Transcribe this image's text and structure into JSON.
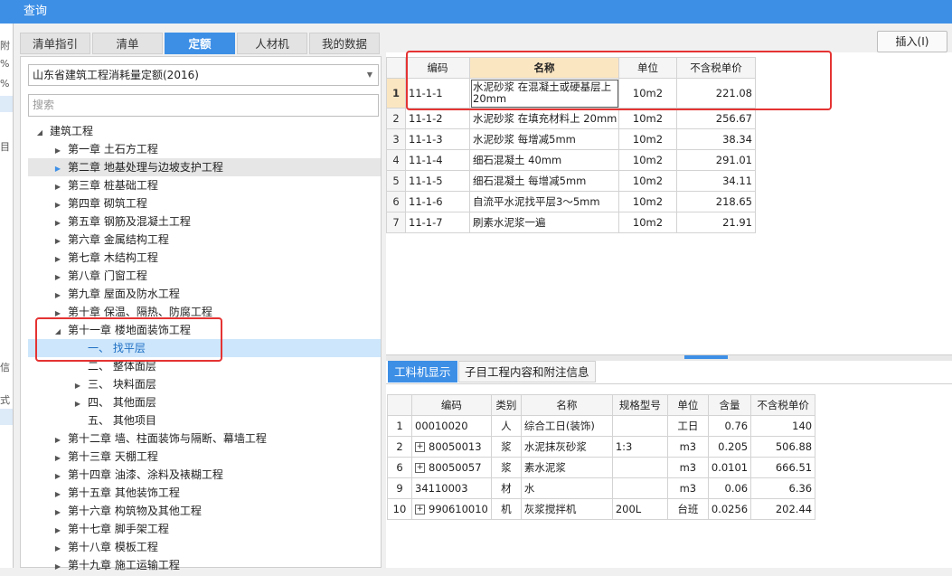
{
  "window": {
    "title": "查询"
  },
  "tabs": [
    "清单指引",
    "清单",
    "定额",
    "人材机",
    "我的数据"
  ],
  "active_tab": "定额",
  "quota_select": "山东省建筑工程消耗量定额(2016)",
  "search_placeholder": "搜索",
  "insert_button": "插入(I)",
  "left_strip": [
    "附",
    "%",
    "%",
    "目",
    "信",
    "式"
  ],
  "tree": [
    {
      "label": "建筑工程",
      "level": 0,
      "toggle": "open"
    },
    {
      "label": "第一章 土石方工程",
      "level": 1,
      "toggle": "closed"
    },
    {
      "label": "第二章 地基处理与边坡支护工程",
      "level": 1,
      "toggle": "closed-blue",
      "state": "hover"
    },
    {
      "label": "第三章 桩基础工程",
      "level": 1,
      "toggle": "closed"
    },
    {
      "label": "第四章 砌筑工程",
      "level": 1,
      "toggle": "closed"
    },
    {
      "label": "第五章 钢筋及混凝土工程",
      "level": 1,
      "toggle": "closed"
    },
    {
      "label": "第六章 金属结构工程",
      "level": 1,
      "toggle": "closed"
    },
    {
      "label": "第七章 木结构工程",
      "level": 1,
      "toggle": "closed"
    },
    {
      "label": "第八章 门窗工程",
      "level": 1,
      "toggle": "closed"
    },
    {
      "label": "第九章 屋面及防水工程",
      "level": 1,
      "toggle": "closed"
    },
    {
      "label": "第十章 保温、隔热、防腐工程",
      "level": 1,
      "toggle": "closed"
    },
    {
      "label": "第十一章 楼地面装饰工程",
      "level": 1,
      "toggle": "open"
    },
    {
      "label": "一、 找平层",
      "level": 2,
      "toggle": "none",
      "state": "selected"
    },
    {
      "label": "二、 整体面层",
      "level": 2,
      "toggle": "none"
    },
    {
      "label": "三、 块料面层",
      "level": 2,
      "toggle": "closed"
    },
    {
      "label": "四、 其他面层",
      "level": 2,
      "toggle": "closed"
    },
    {
      "label": "五、 其他项目",
      "level": 2,
      "toggle": "none"
    },
    {
      "label": "第十二章 墙、柱面装饰与隔断、幕墙工程",
      "level": 1,
      "toggle": "closed"
    },
    {
      "label": "第十三章 天棚工程",
      "level": 1,
      "toggle": "closed"
    },
    {
      "label": "第十四章 油漆、涂料及裱糊工程",
      "level": 1,
      "toggle": "closed"
    },
    {
      "label": "第十五章 其他装饰工程",
      "level": 1,
      "toggle": "closed"
    },
    {
      "label": "第十六章 构筑物及其他工程",
      "level": 1,
      "toggle": "closed"
    },
    {
      "label": "第十七章 脚手架工程",
      "level": 1,
      "toggle": "closed"
    },
    {
      "label": "第十八章 模板工程",
      "level": 1,
      "toggle": "closed"
    },
    {
      "label": "第十九章 施工运输工程",
      "level": 1,
      "toggle": "closed"
    }
  ],
  "quota_table": {
    "headers": [
      "编码",
      "名称",
      "单位",
      "不含税单价"
    ],
    "rows": [
      {
        "no": "1",
        "code": "11-1-1",
        "name": "水泥砂浆 在混凝土或硬基层上 20mm",
        "unit": "10m2",
        "price": "221.08"
      },
      {
        "no": "2",
        "code": "11-1-2",
        "name": "水泥砂浆 在填充材料上 20mm",
        "unit": "10m2",
        "price": "256.67"
      },
      {
        "no": "3",
        "code": "11-1-3",
        "name": "水泥砂浆 每增减5mm",
        "unit": "10m2",
        "price": "38.34"
      },
      {
        "no": "4",
        "code": "11-1-4",
        "name": "细石混凝土 40mm",
        "unit": "10m2",
        "price": "291.01"
      },
      {
        "no": "5",
        "code": "11-1-5",
        "name": "细石混凝土 每增减5mm",
        "unit": "10m2",
        "price": "34.11"
      },
      {
        "no": "6",
        "code": "11-1-6",
        "name": "自流平水泥找平层3～5mm",
        "unit": "10m2",
        "price": "218.65"
      },
      {
        "no": "7",
        "code": "11-1-7",
        "name": "刷素水泥浆一遍",
        "unit": "10m2",
        "price": "21.91"
      }
    ]
  },
  "sub_tabs": [
    "工料机显示",
    "子目工程内容和附注信息"
  ],
  "resource_table": {
    "headers": [
      "编码",
      "类别",
      "名称",
      "规格型号",
      "单位",
      "含量",
      "不含税单价"
    ],
    "rows": [
      {
        "no": "1",
        "expand": false,
        "code": "00010020",
        "cat": "人",
        "name": "综合工日(装饰)",
        "spec": "",
        "unit": "工日",
        "qty": "0.76",
        "price": "140"
      },
      {
        "no": "2",
        "expand": true,
        "code": "80050013",
        "cat": "浆",
        "name": "水泥抹灰砂浆",
        "spec": "1:3",
        "unit": "m3",
        "qty": "0.205",
        "price": "506.88"
      },
      {
        "no": "6",
        "expand": true,
        "code": "80050057",
        "cat": "浆",
        "name": "素水泥浆",
        "spec": "",
        "unit": "m3",
        "qty": "0.0101",
        "price": "666.51"
      },
      {
        "no": "9",
        "expand": false,
        "code": "34110003",
        "cat": "材",
        "name": "水",
        "spec": "",
        "unit": "m3",
        "qty": "0.06",
        "price": "6.36"
      },
      {
        "no": "10",
        "expand": true,
        "code": "990610010",
        "cat": "机",
        "name": "灰浆搅拌机",
        "spec": "200L",
        "unit": "台班",
        "qty": "0.0256",
        "price": "202.44"
      }
    ]
  },
  "colors": {
    "accent": "#3d8fe6",
    "highlight_box": "#e53333",
    "selected_bg": "#cde6fb"
  }
}
